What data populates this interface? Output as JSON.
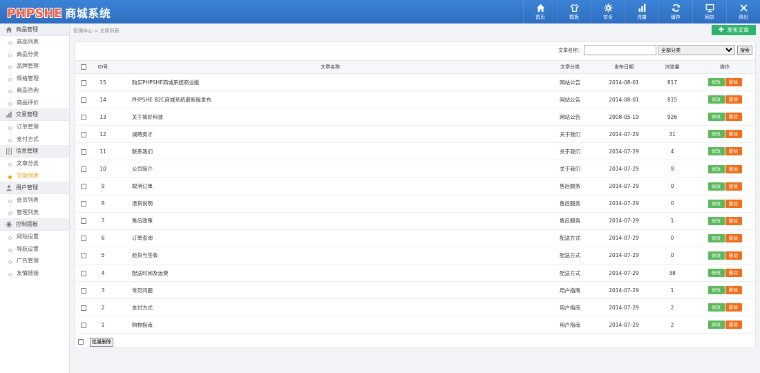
{
  "header": {
    "logo_brand": "PHPSHE",
    "logo_sub": "商城系统",
    "nav": [
      {
        "label": "首页",
        "icon": "home-icon"
      },
      {
        "label": "模板",
        "icon": "shirt-icon"
      },
      {
        "label": "安全",
        "icon": "gear-icon"
      },
      {
        "label": "流量",
        "icon": "bar-chart-icon"
      },
      {
        "label": "缓存",
        "icon": "refresh-icon"
      },
      {
        "label": "网店",
        "icon": "monitor-icon"
      },
      {
        "label": "退出",
        "icon": "close-icon"
      }
    ]
  },
  "sidebar": {
    "groups": [
      {
        "title": "商品管理",
        "icon": "home-icon",
        "items": [
          "商品列表",
          "商品分类",
          "品牌管理",
          "规格管理",
          "商品咨询",
          "商品评价"
        ]
      },
      {
        "title": "交易管理",
        "icon": "bar-chart-icon",
        "items": [
          "订单管理",
          "支付方式"
        ]
      },
      {
        "title": "信息管理",
        "icon": "document-icon",
        "items": [
          "文章分类",
          "文章列表"
        ]
      },
      {
        "title": "用户管理",
        "icon": "user-icon",
        "items": [
          "会员列表",
          "管理列表"
        ]
      },
      {
        "title": "控制面板",
        "icon": "gear-icon",
        "items": [
          "网站设置",
          "导航设置",
          "广告管理",
          "友情链接"
        ]
      }
    ],
    "active_item": "文章列表"
  },
  "breadcrumb": "管理中心 > 文章列表",
  "publish_button": "发布文章",
  "search": {
    "label": "文章名称：",
    "value": "",
    "category_selected": "全部分类",
    "button": "搜索"
  },
  "table": {
    "headers": [
      "ID号",
      "文章名称",
      "文章分类",
      "发布日期",
      "浏览量",
      "操作"
    ],
    "edit_label": "修改",
    "delete_label": "删除",
    "rows": [
      {
        "id": "15",
        "name": "购买PHPSHE商城系统商业版",
        "category": "网站公告",
        "date": "2014-08-01",
        "views": "817"
      },
      {
        "id": "14",
        "name": "PHPSHE B2C商城系统最新版发布",
        "category": "网站公告",
        "date": "2014-08-01",
        "views": "815"
      },
      {
        "id": "13",
        "name": "关于简好科技",
        "category": "网站公告",
        "date": "2008-05-19",
        "views": "926"
      },
      {
        "id": "12",
        "name": "诚聘英才",
        "category": "关于我们",
        "date": "2014-07-29",
        "views": "31"
      },
      {
        "id": "11",
        "name": "联系我们",
        "category": "关于我们",
        "date": "2014-07-29",
        "views": "4"
      },
      {
        "id": "10",
        "name": "公司简介",
        "category": "关于我们",
        "date": "2014-07-29",
        "views": "9"
      },
      {
        "id": "9",
        "name": "取消订单",
        "category": "售后服务",
        "date": "2014-07-29",
        "views": "0"
      },
      {
        "id": "8",
        "name": "退货说明",
        "category": "售后服务",
        "date": "2014-07-29",
        "views": "0"
      },
      {
        "id": "7",
        "name": "售后政策",
        "category": "售后服务",
        "date": "2014-07-29",
        "views": "1"
      },
      {
        "id": "6",
        "name": "订单查询",
        "category": "配送方式",
        "date": "2014-07-29",
        "views": "0"
      },
      {
        "id": "5",
        "name": "验货与签收",
        "category": "配送方式",
        "date": "2014-07-29",
        "views": "0"
      },
      {
        "id": "4",
        "name": "配送时间及运费",
        "category": "配送方式",
        "date": "2014-07-29",
        "views": "38"
      },
      {
        "id": "3",
        "name": "常见问题",
        "category": "用户指南",
        "date": "2014-07-29",
        "views": "1"
      },
      {
        "id": "2",
        "name": "支付方式",
        "category": "用户指南",
        "date": "2014-07-29",
        "views": "2"
      },
      {
        "id": "1",
        "name": "购物指南",
        "category": "用户指南",
        "date": "2014-07-29",
        "views": "2"
      }
    ]
  },
  "batch_delete_label": "批量删除",
  "colors": {
    "header": "#3b83d6",
    "publish": "#2db36c",
    "edit": "#5cb85c",
    "delete": "#f06d1a",
    "active": "#f39c12"
  }
}
